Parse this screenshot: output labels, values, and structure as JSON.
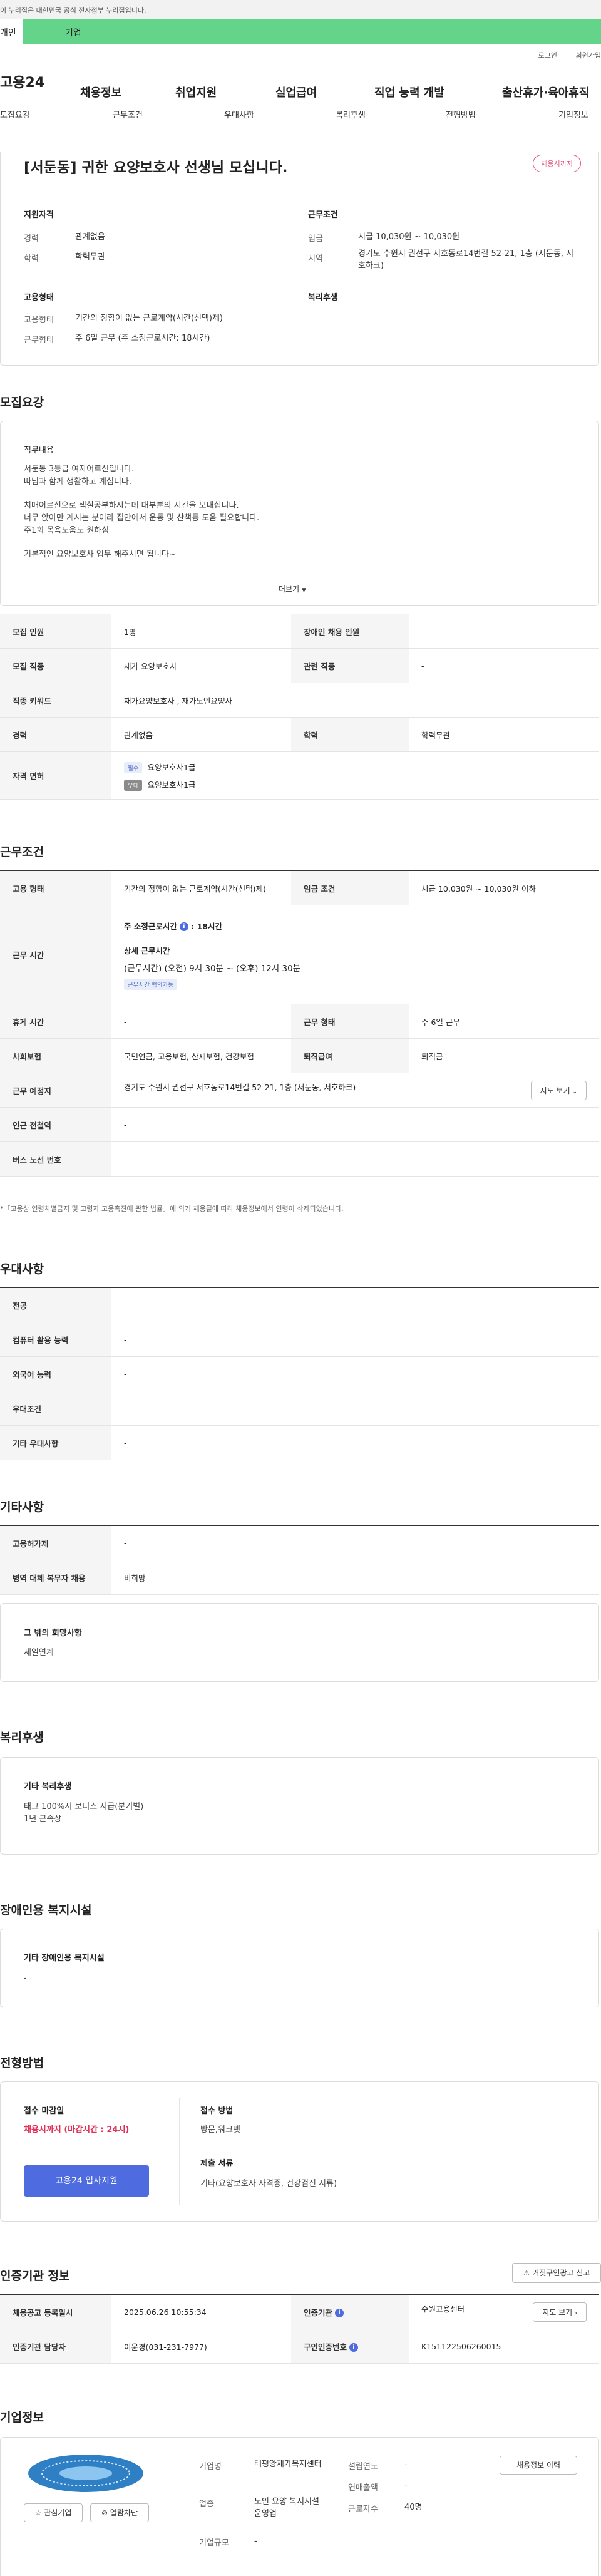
{
  "gov_notice": "이 누리집은 대한민국 공식 전자정부 누리집입니다.",
  "tabs": {
    "person": "개인",
    "company": "기업"
  },
  "util_links": [
    "로그인",
    "회원가입"
  ],
  "site_logo": "고용24",
  "gnb": [
    "채용정보",
    "취업지원",
    "실업급여",
    "직업 능력 개발",
    "출산휴가·육아휴직"
  ],
  "subnav": [
    "모집요강",
    "근무조건",
    "우대사항",
    "복리후생",
    "전형방법",
    "기업정보"
  ],
  "job": {
    "title": "[서둔동] 귀한 요양보호사 선생님 모십니다.",
    "status_badge": "채용시까지",
    "qual_heading": "지원자격",
    "cond_heading": "근무조건",
    "emp_heading": "고용형태",
    "welfare_heading": "복리후생",
    "qual": [
      {
        "label": "경력",
        "value": "관계없음"
      },
      {
        "label": "학력",
        "value": "학력무관"
      }
    ],
    "cond": [
      {
        "label": "임금",
        "value": "시급 10,030원 ~ 10,030원"
      },
      {
        "label": "지역",
        "value": "경기도 수원시 권선구 서호동로14번길 52-21, 1층 (서둔동, 서호하크)"
      }
    ],
    "emp": [
      {
        "label": "고용형태",
        "value": "기간의 정함이 없는 근로계약(시간(선택)제)"
      },
      {
        "label": "근무형태",
        "value": "주 6일 근무 (주 소정근로시간: 18시간)"
      }
    ]
  },
  "recruit": {
    "section_title": "모집요강",
    "duty_title": "직무내용",
    "duty_lines": [
      "서둔동 3등급 여자어르신입니다.",
      "따님과 함께 생활하고 계십니다.",
      "",
      "치매어르신으로 색칠공부하시는데 대부분의 시간을 보내십니다.",
      "너무 앉아만 계시는 분이라 집안에서 운동 및 산책등 도움 필요합니다.",
      "주1회 목욕도움도 원하심",
      "",
      "기본적인 요양보호사 업무 해주시면 됩니다~"
    ],
    "more_label": "더보기",
    "rows": {
      "count_label": "모집 인원",
      "count": "1명",
      "disabled_label": "장애인 채용 인원",
      "disabled": "-",
      "job_label": "모집 직종",
      "job": "재가 요양보호사",
      "related_label": "관련 직종",
      "related": "-",
      "keyword_label": "직종 키워드",
      "keyword": "재가요양보호사 , 재가노인요양사",
      "career_label": "경력",
      "career": "관계없음",
      "edu_label": "학력",
      "edu": "학력무관",
      "license_label": "자격 면허",
      "license_required_tag": "필수",
      "license_required": "요양보호사1급",
      "license_pref_tag": "우대",
      "license_pref": "요양보호사1급"
    }
  },
  "work": {
    "section_title": "근무조건",
    "emp_type_label": "고용 형태",
    "emp_type": "기간의 정함이 없는 근로계약(시간(선택)제)",
    "wage_label": "임금 조건",
    "wage": "시급 10,030원 ~ 10,030원 이하",
    "hours_label": "근무 시간",
    "weekly_hours_title": "주 소정근로시간",
    "weekly_hours": ": 18시간",
    "detail_title": "상세 근무시간",
    "detail": "(근무시간) (오전) 9시 30분 ~ (오후) 12시 30분",
    "flex_tag": "근무시간 협의가능",
    "break_label": "휴게 시간",
    "break": "-",
    "shape_label": "근무 형태",
    "shape": "주 6일 근무",
    "insurance_label": "사회보험",
    "insurance": "국민연금, 고용보험, 산재보험, 건강보험",
    "severance_label": "퇴직급여",
    "severance": "퇴직금",
    "place_label": "근무 예정지",
    "place": "경기도 수원시 권선구 서호동로14번길 52-21, 1층 (서둔동, 서호하크)",
    "map_button": "지도 보기",
    "subway_label": "인근 전철역",
    "subway": "-",
    "bus_label": "버스 노선 번호",
    "bus": "-",
    "notice": "*「고용상 연령차별금지 및 고령자 고용촉진에 관한 법률」에 의거 채용될에 따라 채용정보에서 연령이 삭제되었습니다."
  },
  "pref": {
    "section_title": "우대사항",
    "rows": [
      {
        "label": "전공",
        "value": "-"
      },
      {
        "label": "컴퓨터 활용 능력",
        "value": "-"
      },
      {
        "label": "외국어 능력",
        "value": "-"
      },
      {
        "label": "우대조건",
        "value": "-"
      },
      {
        "label": "기타 우대사항",
        "value": "-"
      }
    ]
  },
  "etc": {
    "section_title": "기타사항",
    "rows": [
      {
        "label": "고용허가제",
        "value": "-"
      },
      {
        "label": "병역 대체 복무자 채용",
        "value": "비희망"
      }
    ],
    "other_title": "그 밖의 희망사항",
    "other_value": "세일연계"
  },
  "welfare": {
    "section_title": "복리후생",
    "box_title": "기타 복리후생",
    "lines": [
      "태그 100%시 보너스 지급(분기별)",
      "1년 근속상"
    ]
  },
  "disabled_fac": {
    "section_title": "장애인용 복지시설",
    "box_title": "기타 장애인용 복지시설",
    "value": "-"
  },
  "selection": {
    "section_title": "전형방법",
    "deadline_title": "접수 마감일",
    "deadline": "채용시까지 (마감시간 : 24시)",
    "apply_button": "고용24 입사지원",
    "method_title": "접수 방법",
    "method": "방문,워크넷",
    "docs_title": "제출 서류",
    "docs": "기타(요양보호사 자격증, 건강검진 서류)"
  },
  "cert": {
    "section_title": "인증기관 정보",
    "report_button": "거짓구인광고 신고",
    "reg_label": "채용공고 등록일시",
    "reg": "2025.06.26 10:55:34",
    "agency_label": "인증기관",
    "agency": "수원고용센터",
    "map_button": "지도 보기",
    "manager_label": "인증기관 담당자",
    "manager": "이윤경(031-231-7977)",
    "reqno_label": "구인인증번호",
    "reqno": "K151122506260015"
  },
  "company": {
    "section_title": "기업정보",
    "fav_button": "관심기업",
    "block_button": "열람차단",
    "history_button": "채용정보 이력",
    "name_label": "기업명",
    "name": "태평양재가복지센터",
    "founded_label": "설립연도",
    "founded": "-",
    "industry_label": "업종",
    "industry": "노인 요양 복지시설 운영업",
    "sales_label": "연매출액",
    "sales": "-",
    "employees_label": "근로자수",
    "employees": "40명",
    "size_label": "기업규모",
    "size": "-"
  },
  "icons": {
    "chevron": "chevron-down-icon",
    "star": "star-icon",
    "block": "block-icon",
    "info": "info-icon",
    "map": "map-icon",
    "report": "report-icon"
  },
  "colors": {
    "brand_green": "#63d48a",
    "primary_blue": "#4e6be0",
    "alert_red": "#e0557a"
  }
}
